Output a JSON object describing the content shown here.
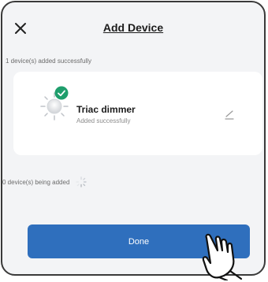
{
  "header": {
    "title": "Add Device",
    "close_icon": "close-icon"
  },
  "added_section": {
    "label": "1 device(s) added successfully"
  },
  "device": {
    "name": "Triac dimmer",
    "status": "Added successfully",
    "icon": "bulb-icon",
    "badge_icon": "check-icon",
    "edit_icon": "edit-icon"
  },
  "adding_section": {
    "label": "0 device(s) being added",
    "icon": "spinner-icon"
  },
  "actions": {
    "done_label": "Done"
  },
  "overlay": {
    "icon": "pointing-hand-icon"
  },
  "colors": {
    "primary": "#2f6fbd",
    "success": "#1f9e6c",
    "background": "#f3f4f6",
    "card": "#ffffff"
  }
}
